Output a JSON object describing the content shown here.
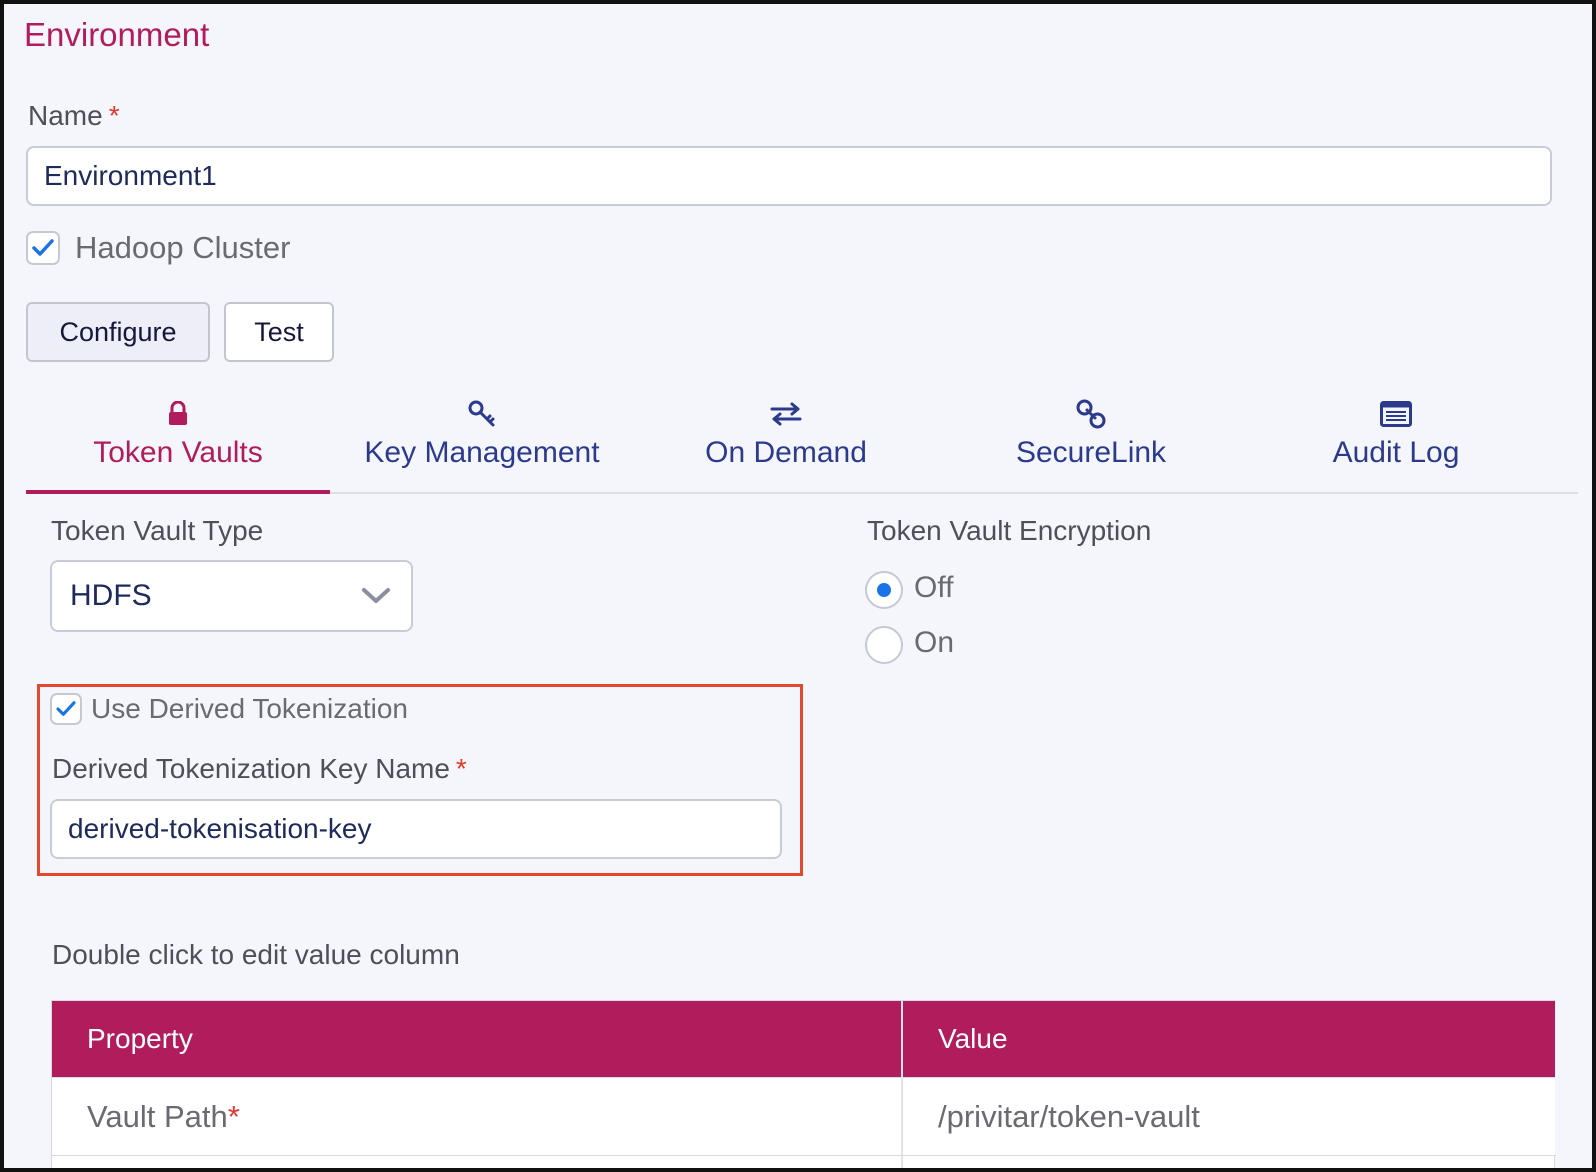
{
  "section": {
    "title": "Environment"
  },
  "name_field": {
    "label": "Name",
    "required_mark": "*",
    "value": "Environment1"
  },
  "hadoop": {
    "label": "Hadoop Cluster",
    "checked": true
  },
  "buttons": {
    "configure": "Configure",
    "test": "Test"
  },
  "tabs": [
    {
      "label": "Token Vaults",
      "icon": "lock-icon",
      "active": true
    },
    {
      "label": "Key Management",
      "icon": "key-icon",
      "active": false
    },
    {
      "label": "On Demand",
      "icon": "arrows-exchange-icon",
      "active": false
    },
    {
      "label": "SecureLink",
      "icon": "link-icon",
      "active": false
    },
    {
      "label": "Audit Log",
      "icon": "list-icon",
      "active": false
    }
  ],
  "token_vault_type": {
    "label": "Token Vault Type",
    "selected": "HDFS"
  },
  "encryption": {
    "label": "Token Vault Encryption",
    "options": [
      "Off",
      "On"
    ],
    "selected": "Off"
  },
  "derived": {
    "checkbox_label": "Use Derived Tokenization",
    "checked": true,
    "key_label": "Derived Tokenization Key Name",
    "required_mark": "*",
    "key_value": "derived-tokenisation-key"
  },
  "table": {
    "hint": "Double click to edit value column",
    "headers": [
      "Property",
      "Value"
    ],
    "rows": [
      {
        "property": "Vault Path",
        "required_mark": "*",
        "value": "/privitar/token-vault"
      }
    ]
  },
  "colors": {
    "accent": "#b01c5c",
    "tab_text": "#2b3a8c",
    "required": "#e03a2f",
    "highlight_box": "#e24a2f",
    "check_blue": "#1a73e8"
  }
}
